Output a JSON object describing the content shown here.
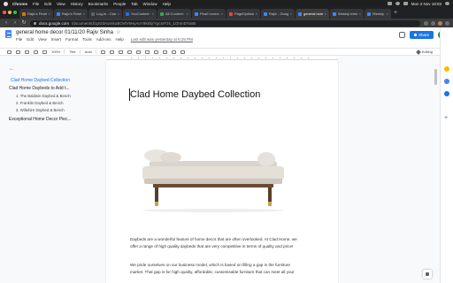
{
  "menubar": {
    "app": "Chrome",
    "items": [
      "File",
      "Edit",
      "View",
      "History",
      "Bookmarks",
      "People",
      "Tab",
      "Window",
      "Help"
    ],
    "clock": "Mon 2 Nov 18:03"
  },
  "tabs": [
    {
      "label": "Rajiv's Pearl Lo",
      "color": "#e37400"
    },
    {
      "label": "Rajiv's Pearl Lo",
      "color": "#4285f4"
    },
    {
      "label": "Log-in - Classic",
      "color": "#5f6368"
    },
    {
      "label": "YouContext Onl",
      "color": "#1a73e8"
    },
    {
      "label": "All Content: Fe",
      "color": "#34a853"
    },
    {
      "label": "Pearl Lemon D",
      "color": "#4285f4"
    },
    {
      "label": "PageOptimizer Pr",
      "color": "#ea4335"
    },
    {
      "label": "Rajiv - Google",
      "color": "#4285f4"
    },
    {
      "label": "general home",
      "color": "#4285f4",
      "active": true
    },
    {
      "label": "Weekly Intern",
      "color": "#4285f4"
    },
    {
      "label": "Weekly Intern",
      "color": "#4285f4"
    }
  ],
  "address": {
    "host": "docs.google.com",
    "path": "/document/d/1pOdAurnkuBOvfV9HyAnY9kkhjrYgcsrF2s_1OmnDYasB"
  },
  "doc": {
    "title": "general home decor 01/11/20 Rajiv Sinha",
    "menu": [
      "File",
      "Edit",
      "View",
      "Insert",
      "Format",
      "Tools",
      "Add-ons",
      "Help"
    ],
    "last_edit": "Last edit was yesterday at 6:25 PM",
    "share_label": "Share"
  },
  "format_toolbar": {
    "zoom": "100%",
    "style": "Title",
    "font": "Arial",
    "mode": "Editing"
  },
  "outline": [
    {
      "label": "Clad Home Daybed Collection",
      "level": 1,
      "active": true
    },
    {
      "label": "Clad Home Daybeds to Add t...",
      "level": 1
    },
    {
      "label": "1. The Baldwin Daybed & Bench",
      "level": 2
    },
    {
      "label": "2. Franklin Daybed & Bench",
      "level": 2
    },
    {
      "label": "3. Wiltshire Daybed & Bench",
      "level": 2
    },
    {
      "label": "Exceptional Home Decor Piec...",
      "level": 1
    }
  ],
  "page": {
    "heading": "Clad Home Daybed Collection",
    "paragraph1": [
      "Daybeds are a wonderful feature of home decor that are often overlooked.  At Clad Home, we",
      "offer a range of high quality daybeds that are very competitive in terms of quality and price!"
    ],
    "paragraph2": [
      "We pride ourselves on our business model, which is based on filling a gap in the furniture",
      "market.  That gap is for high quality, affordable, customisable furniture that can meet all your"
    ]
  },
  "colors": {
    "share_blue": "#1a73e8",
    "docs_blue": "#4285f4",
    "outline_active": "#1a73e8"
  }
}
